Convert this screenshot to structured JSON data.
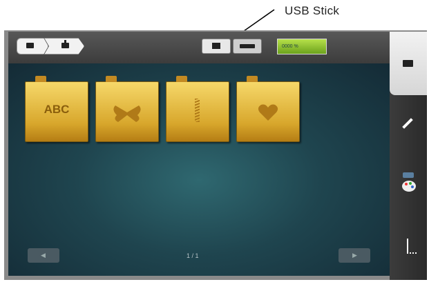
{
  "annotation": {
    "label": "USB Stick"
  },
  "topbar": {
    "memory_label": "0000 %",
    "breadcrumb": [
      {
        "icon": "folder-icon"
      },
      {
        "icon": "folder-up-icon"
      }
    ],
    "sources": [
      {
        "icon": "machine-memory-icon",
        "selected": true
      },
      {
        "icon": "usb-stick-icon",
        "selected": false
      }
    ],
    "memory_bar_fill": 1.0
  },
  "folders": [
    {
      "label": "ABC",
      "icon": "alphabet-icon"
    },
    {
      "label": "",
      "icon": "butterfly-icon"
    },
    {
      "label": "",
      "icon": "zigzag-icon"
    },
    {
      "label": "",
      "icon": "heart-icon"
    }
  ],
  "pagination": {
    "page": "1 / 1"
  },
  "sidebar": {
    "items": [
      {
        "icon": "folder-icon",
        "active": true
      },
      {
        "icon": "pencil-icon",
        "active": false
      },
      {
        "icon": "palette-icon",
        "active": false
      },
      {
        "icon": "ruler-icon",
        "active": false
      }
    ]
  },
  "colors": {
    "folder": "#e3b845",
    "background": "#1f454f",
    "memory_bar": "#8ec02c",
    "topbar": "#4a4a4a"
  }
}
